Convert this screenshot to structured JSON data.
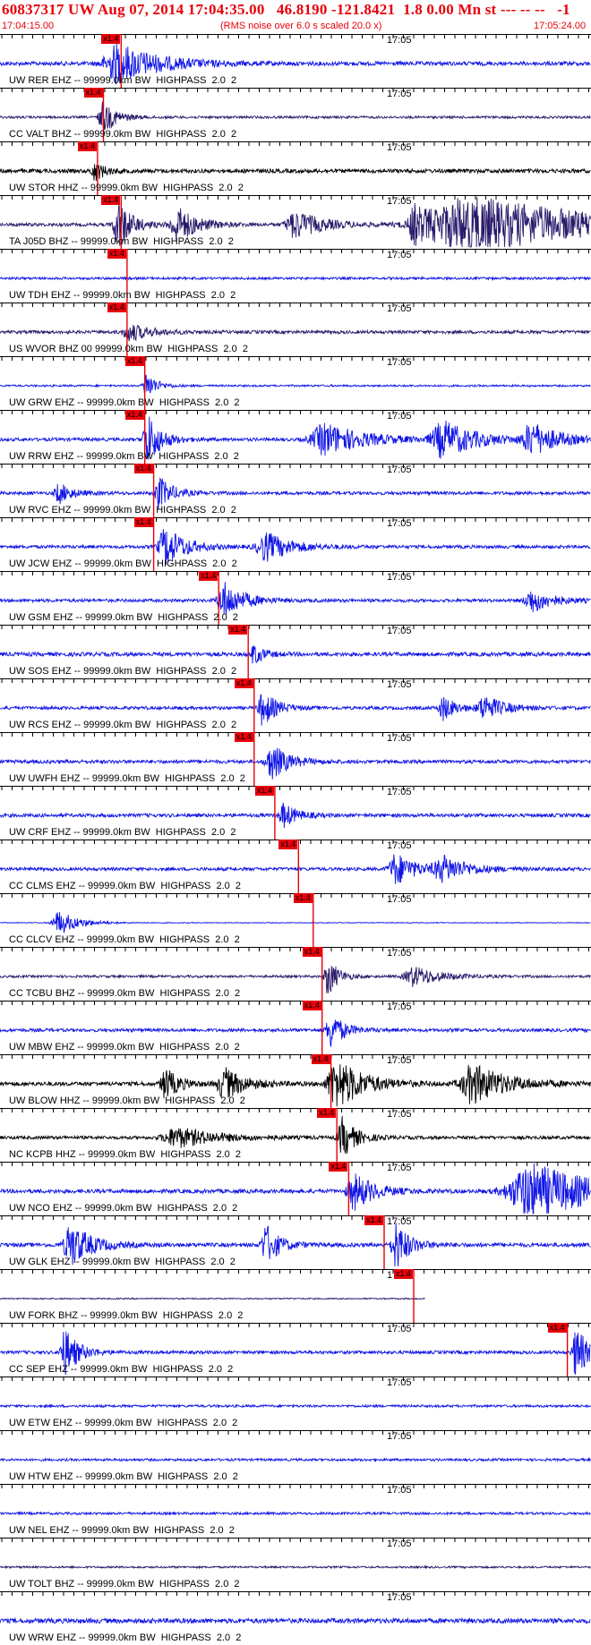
{
  "header": {
    "title": "60837317 UW Aug 07, 2014 17:04:35.00   46.8190 -121.8421  1.8 0.00 Mn st --- -- --   -1",
    "start_time": "17:04:15.00",
    "noise_note": "(RMS noise over 6.0 s scaled 20.0 x)",
    "end_time": "17:05:24.00"
  },
  "time_mark": "17:05",
  "pick_tag": "x1.4",
  "colors": {
    "red": "#e8000a",
    "blue": "#0f14e6",
    "navy": "#2a1a6b",
    "black": "#000000"
  },
  "traces": [
    {
      "label": "UW RER EHZ -- 99999.0km BW  HIGHPASS  2.0  2",
      "color": "#0f14e6",
      "noise": 0.25,
      "pick": 0.205,
      "bursts": [
        [
          0.2,
          0.06,
          1.0
        ]
      ],
      "clip": 0.0,
      "lgap": 0
    },
    {
      "label": "CC VALT BHZ -- 99999.0km BW  HIGHPASS  2.0  2",
      "color": "#2a1a6b",
      "noise": 0.15,
      "pick": 0.175,
      "bursts": [
        [
          0.175,
          0.02,
          0.8
        ]
      ],
      "clip": 0.0,
      "lgap": 0
    },
    {
      "label": "UW STOR HHZ -- 99999.0km BW  HIGHPASS  2.0  2",
      "color": "#000000",
      "noise": 0.25,
      "pick": 0.165,
      "bursts": [
        [
          0.16,
          0.015,
          0.5
        ]
      ],
      "clip": 0.0,
      "lgap": 0
    },
    {
      "label": "TA J05D BHZ -- 99999.0km BW  HIGHPASS  2.0  2",
      "color": "#2a1a6b",
      "noise": 0.2,
      "pick": 0.205,
      "bursts": [
        [
          0.2,
          0.02,
          1.3
        ],
        [
          0.3,
          0.03,
          0.9
        ],
        [
          0.5,
          0.04,
          0.7
        ],
        [
          0.7,
          0.02,
          0.9
        ],
        [
          0.8,
          0.2,
          1.4
        ]
      ],
      "clip": 0.0,
      "lgap": 0
    },
    {
      "label": "UW TDH EHZ -- 99999.0km BW  HIGHPASS  2.0  2",
      "color": "#0f14e6",
      "noise": 0.15,
      "pick": 0.215,
      "bursts": [],
      "clip": 0.0,
      "lgap": 0
    },
    {
      "label": "US WVOR BHZ 00 99999.0km BW  HIGHPASS  2.0  2",
      "color": "#2a1a6b",
      "noise": 0.2,
      "pick": 0.215,
      "bursts": [
        [
          0.22,
          0.03,
          0.45
        ]
      ],
      "clip": 0.0,
      "lgap": 0
    },
    {
      "label": "UW GRW EHZ -- 99999.0km BW  HIGHPASS  2.0  2",
      "color": "#0f14e6",
      "noise": 0.12,
      "pick": 0.245,
      "bursts": [
        [
          0.248,
          0.015,
          0.7
        ]
      ],
      "clip": 0.0,
      "lgap": 0
    },
    {
      "label": "UW RRW EHZ -- 99999.0km BW  HIGHPASS  2.0  2",
      "color": "#0f14e6",
      "noise": 0.2,
      "pick": 0.245,
      "bursts": [
        [
          0.25,
          0.02,
          1.3
        ],
        [
          0.55,
          0.06,
          0.8
        ],
        [
          0.75,
          0.05,
          0.9
        ],
        [
          0.9,
          0.04,
          0.8
        ]
      ],
      "clip": 0.0,
      "lgap": 0
    },
    {
      "label": "UW RVC EHZ -- 99999.0km BW  HIGHPASS  2.0  2",
      "color": "#0f14e6",
      "noise": 0.2,
      "pick": 0.26,
      "bursts": [
        [
          0.27,
          0.02,
          0.8
        ],
        [
          0.1,
          0.02,
          0.5
        ]
      ],
      "clip": 0.0,
      "lgap": 0
    },
    {
      "label": "UW JCW EHZ -- 99999.0km BW  HIGHPASS  2.0  2",
      "color": "#0f14e6",
      "noise": 0.2,
      "pick": 0.26,
      "bursts": [
        [
          0.28,
          0.03,
          1.0
        ],
        [
          0.45,
          0.04,
          0.7
        ]
      ],
      "clip": 0.0,
      "lgap": 0
    },
    {
      "label": "UW GSM EHZ -- 99999.0km BW  HIGHPASS  2.0  2",
      "color": "#0f14e6",
      "noise": 0.2,
      "pick": 0.37,
      "bursts": [
        [
          0.38,
          0.03,
          0.9
        ],
        [
          0.9,
          0.03,
          0.6
        ]
      ],
      "clip": 0.0,
      "lgap": 0
    },
    {
      "label": "UW SOS EHZ -- 99999.0km BW  HIGHPASS  2.0  2",
      "color": "#0f14e6",
      "noise": 0.25,
      "pick": 0.42,
      "bursts": [
        [
          0.43,
          0.015,
          0.5
        ]
      ],
      "clip": 0.0,
      "lgap": 0
    },
    {
      "label": "UW RCS EHZ -- 99999.0km BW  HIGHPASS  2.0  2",
      "color": "#0f14e6",
      "noise": 0.2,
      "pick": 0.43,
      "bursts": [
        [
          0.445,
          0.02,
          0.9
        ],
        [
          0.75,
          0.02,
          0.6
        ],
        [
          0.82,
          0.03,
          0.6
        ]
      ],
      "clip": 0.0,
      "lgap": 0
    },
    {
      "label": "UW UWFH EHZ -- 99999.0km BW  HIGHPASS  2.0  2",
      "color": "#0f14e6",
      "noise": 0.22,
      "pick": 0.43,
      "bursts": [
        [
          0.46,
          0.025,
          0.9
        ]
      ],
      "clip": 0.0,
      "lgap": 0
    },
    {
      "label": "UW CRF EHZ -- 99999.0km BW  HIGHPASS  2.0  2",
      "color": "#0f14e6",
      "noise": 0.22,
      "pick": 0.465,
      "bursts": [
        [
          0.48,
          0.02,
          0.6
        ]
      ],
      "clip": 0.0,
      "lgap": 0
    },
    {
      "label": "CC CLMS EHZ -- 99999.0km BW  HIGHPASS  2.0  2",
      "color": "#0f14e6",
      "noise": 0.2,
      "pick": 0.505,
      "bursts": [
        [
          0.67,
          0.03,
          0.8
        ],
        [
          0.75,
          0.04,
          0.6
        ]
      ],
      "clip": 0.0,
      "lgap": 0
    },
    {
      "label": "CC CLCV EHZ -- 99999.0km BW  HIGHPASS  2.0  2",
      "color": "#0f14e6",
      "noise": 0.05,
      "pick": 0.53,
      "bursts": [
        [
          0.1,
          0.03,
          0.6
        ]
      ],
      "clip": 0.0,
      "lgap": 0
    },
    {
      "label": "CC TCBU BHZ -- 99999.0km BW  HIGHPASS  2.0  2",
      "color": "#2a1a6b",
      "noise": 0.15,
      "pick": 0.545,
      "bursts": [
        [
          0.555,
          0.015,
          1.0
        ],
        [
          0.7,
          0.04,
          0.5
        ]
      ],
      "clip": 0.0,
      "lgap": 0
    },
    {
      "label": "UW MBW EHZ -- 99999.0km BW  HIGHPASS  2.0  2",
      "color": "#0f14e6",
      "noise": 0.2,
      "pick": 0.545,
      "bursts": [
        [
          0.56,
          0.02,
          0.9
        ]
      ],
      "clip": 0.0,
      "lgap": 0
    },
    {
      "label": "UW BLOW HHZ -- 99999.0km BW  HIGHPASS  2.0  2",
      "color": "#000000",
      "noise": 0.25,
      "pick": 0.56,
      "bursts": [
        [
          0.28,
          0.02,
          0.8
        ],
        [
          0.38,
          0.03,
          0.8
        ],
        [
          0.57,
          0.04,
          1.3
        ],
        [
          0.8,
          0.05,
          1.0
        ]
      ],
      "clip": 0.0,
      "lgap": 0
    },
    {
      "label": "NC KCPB HHZ -- 99999.0km BW  HIGHPASS  2.0  2",
      "color": "#000000",
      "noise": 0.2,
      "pick": 0.57,
      "bursts": [
        [
          0.3,
          0.06,
          0.5
        ],
        [
          0.58,
          0.02,
          1.0
        ]
      ],
      "clip": 0.0,
      "lgap": 0
    },
    {
      "label": "UW NCO EHZ -- 99999.0km BW  HIGHPASS  2.0  2",
      "color": "#0f14e6",
      "noise": 0.25,
      "pick": 0.59,
      "bursts": [
        [
          0.6,
          0.03,
          0.9
        ],
        [
          0.9,
          0.1,
          1.4
        ]
      ],
      "clip": 0.0,
      "lgap": 0
    },
    {
      "label": "UW GLK EHZ -- 99999.0km BW  HIGHPASS  2.0  2",
      "color": "#0f14e6",
      "noise": 0.25,
      "pick": 0.65,
      "bursts": [
        [
          0.12,
          0.03,
          1.1
        ],
        [
          0.45,
          0.02,
          1.0
        ],
        [
          0.67,
          0.02,
          1.2
        ]
      ],
      "clip": 0.0,
      "lgap": 0
    },
    {
      "label": "UW FORK BHZ -- 99999.0km BW  HIGHPASS  2.0  2",
      "color": "#2a1a6b",
      "noise": 0.08,
      "pick": 0.7,
      "bursts": [],
      "clip": 0.72,
      "lgap": 0
    },
    {
      "label": "CC SEP EHZ -- 99999.0km BW  HIGHPASS  2.0  2",
      "color": "#0f14e6",
      "noise": 0.2,
      "pick": 0.96,
      "bursts": [
        [
          0.11,
          0.02,
          1.2
        ],
        [
          0.975,
          0.015,
          1.5
        ]
      ],
      "clip": 0.0,
      "lgap": 0
    },
    {
      "label": "UW ETW EHZ -- 99999.0km BW  HIGHPASS  2.0  2",
      "color": "#0f14e6",
      "noise": 0.15,
      "pick": null,
      "bursts": [],
      "clip": 0.0,
      "lgap": 0
    },
    {
      "label": "UW HTW EHZ -- 99999.0km BW  HIGHPASS  2.0  2",
      "color": "#0f14e6",
      "noise": 0.15,
      "pick": null,
      "bursts": [],
      "clip": 0.0,
      "lgap": 0
    },
    {
      "label": "UW NEL EHZ -- 99999.0km BW  HIGHPASS  2.0  2",
      "color": "#0f14e6",
      "noise": 0.15,
      "pick": null,
      "bursts": [],
      "clip": 0.0,
      "lgap": 0
    },
    {
      "label": "UW TOLT BHZ -- 99999.0km BW  HIGHPASS  2.0  2",
      "color": "#2a1a6b",
      "noise": 0.12,
      "pick": null,
      "bursts": [],
      "clip": 0.0,
      "lgap": 0
    },
    {
      "label": "UW WRW EHZ -- 99999.0km BW  HIGHPASS  2.0  2",
      "color": "#0f14e6",
      "noise": 0.3,
      "pick": null,
      "bursts": [],
      "clip": 0.0,
      "lgap": 0
    }
  ]
}
